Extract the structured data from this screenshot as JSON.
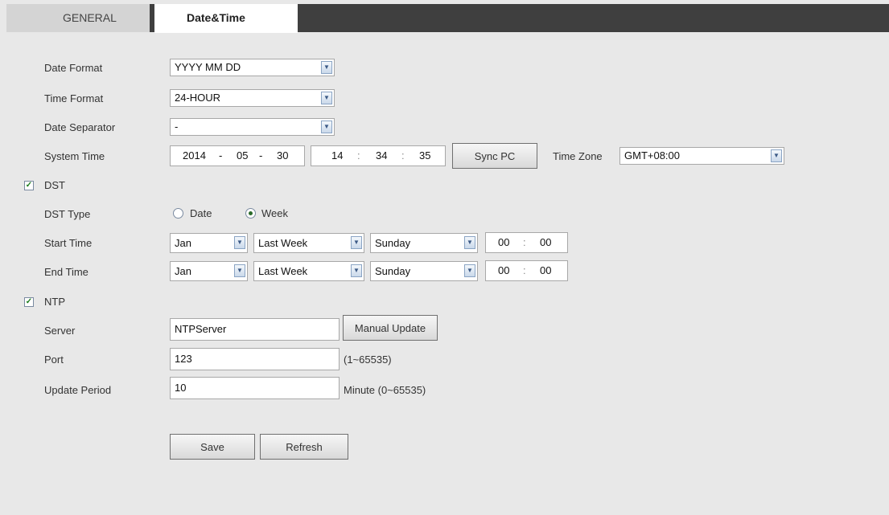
{
  "tabs": {
    "general": "GENERAL",
    "datetime": "Date&Time"
  },
  "date_format": {
    "label": "Date Format",
    "value": "YYYY MM DD"
  },
  "time_format": {
    "label": "Time Format",
    "value": "24-HOUR"
  },
  "date_separator": {
    "label": "Date Separator",
    "value": "-"
  },
  "system_time": {
    "label": "System Time",
    "year": "2014",
    "month": "05",
    "day": "30",
    "date_sep": "-",
    "hour": "14",
    "minute": "34",
    "second": "35",
    "time_sep": ":",
    "sync_button": "Sync PC",
    "timezone_label": "Time Zone",
    "timezone_value": "GMT+08:00"
  },
  "dst": {
    "checkbox_label": "DST",
    "checked": true,
    "type_label": "DST Type",
    "option_date": "Date",
    "option_week": "Week",
    "selected_option": "Week",
    "start": {
      "label": "Start Time",
      "month": "Jan",
      "week": "Last Week",
      "day": "Sunday",
      "hour": "00",
      "minute": "00"
    },
    "end": {
      "label": "End Time",
      "month": "Jan",
      "week": "Last Week",
      "day": "Sunday",
      "hour": "00",
      "minute": "00"
    },
    "time_sep": ":"
  },
  "ntp": {
    "checkbox_label": "NTP",
    "checked": true,
    "server_label": "Server",
    "server_value": "NTPServer",
    "manual_update_button": "Manual Update",
    "port_label": "Port",
    "port_value": "123",
    "port_hint": "(1~65535)",
    "period_label": "Update Period",
    "period_value": "10",
    "period_hint": "Minute (0~65535)"
  },
  "buttons": {
    "save": "Save",
    "refresh": "Refresh"
  }
}
